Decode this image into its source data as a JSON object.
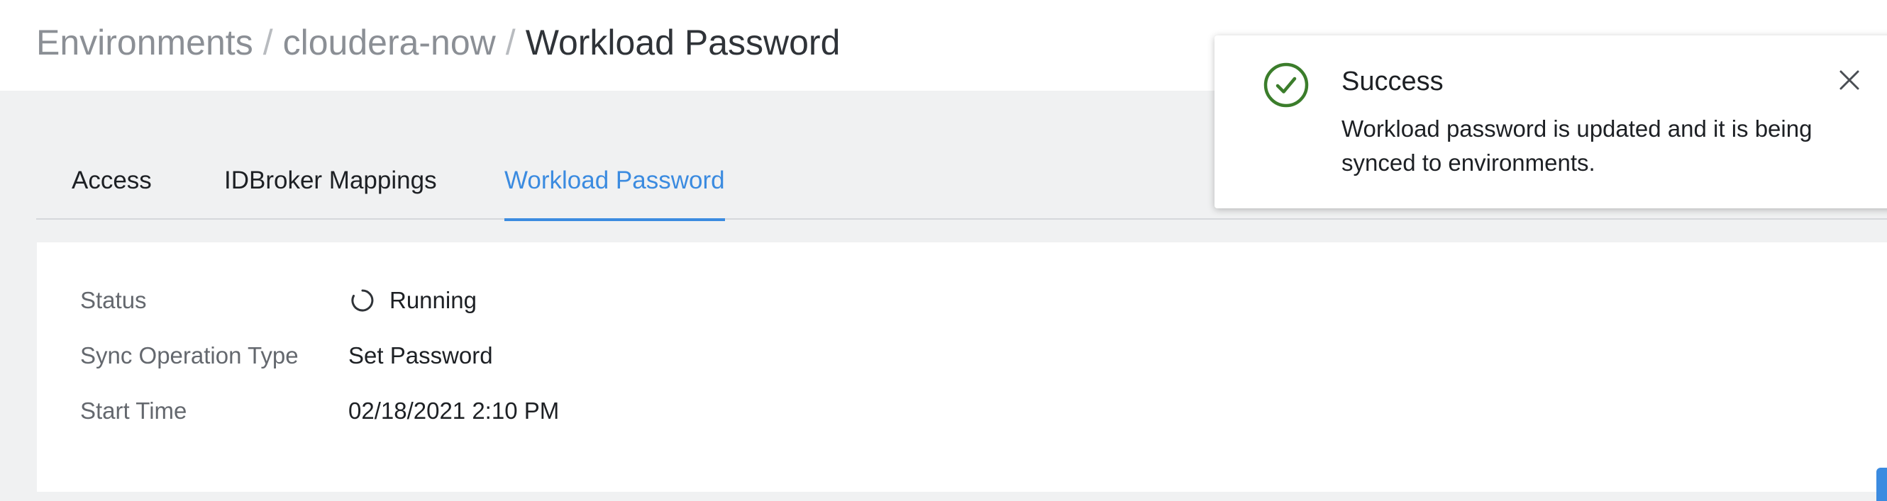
{
  "breadcrumb": {
    "items": [
      "Environments",
      "cloudera-now"
    ],
    "separator": "/",
    "current": "Workload Password"
  },
  "tabs": [
    {
      "label": "Access",
      "active": false
    },
    {
      "label": "IDBroker Mappings",
      "active": false
    },
    {
      "label": "Workload Password",
      "active": true
    }
  ],
  "details": {
    "status": {
      "label": "Status",
      "value": "Running",
      "icon": "spinner-icon"
    },
    "sync_operation_type": {
      "label": "Sync Operation Type",
      "value": "Set Password"
    },
    "start_time": {
      "label": "Start Time",
      "value": "02/18/2021 2:10 PM"
    }
  },
  "toast": {
    "title": "Success",
    "message": "Workload password is updated and it is being synced to environments.",
    "icon": "check-circle-icon",
    "close_icon": "close-icon"
  },
  "colors": {
    "accent": "#3b8be0",
    "success": "#3b7d2b",
    "page_background": "#f0f1f2"
  }
}
